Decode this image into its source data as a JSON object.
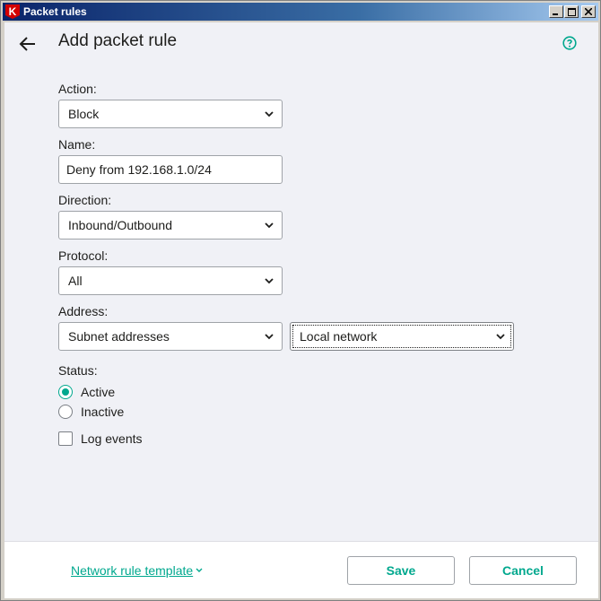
{
  "window": {
    "title": "Packet rules",
    "app_icon_letter": "K",
    "controls": [
      "minimize-icon",
      "maximize-icon",
      "close-icon"
    ]
  },
  "header": {
    "title": "Add packet rule",
    "back_icon": "arrow-left-icon",
    "help_icon": "question-circle-icon"
  },
  "form": {
    "action": {
      "label": "Action:",
      "value": "Block"
    },
    "name": {
      "label": "Name:",
      "value": "Deny from 192.168.1.0/24"
    },
    "direction": {
      "label": "Direction:",
      "value": "Inbound/Outbound"
    },
    "protocol": {
      "label": "Protocol:",
      "value": "All"
    },
    "address": {
      "label": "Address:",
      "type_value": "Subnet addresses",
      "network_value": "Local network"
    },
    "status": {
      "label": "Status:",
      "options": [
        {
          "label": "Active",
          "selected": true
        },
        {
          "label": "Inactive",
          "selected": false
        }
      ]
    },
    "log_events": {
      "label": "Log events",
      "checked": false
    }
  },
  "footer": {
    "template_link": "Network rule template",
    "save_label": "Save",
    "cancel_label": "Cancel"
  },
  "colors": {
    "accent": "#00a88e",
    "title_bar": "#0a246a",
    "content_bg": "#f0f1f6"
  }
}
